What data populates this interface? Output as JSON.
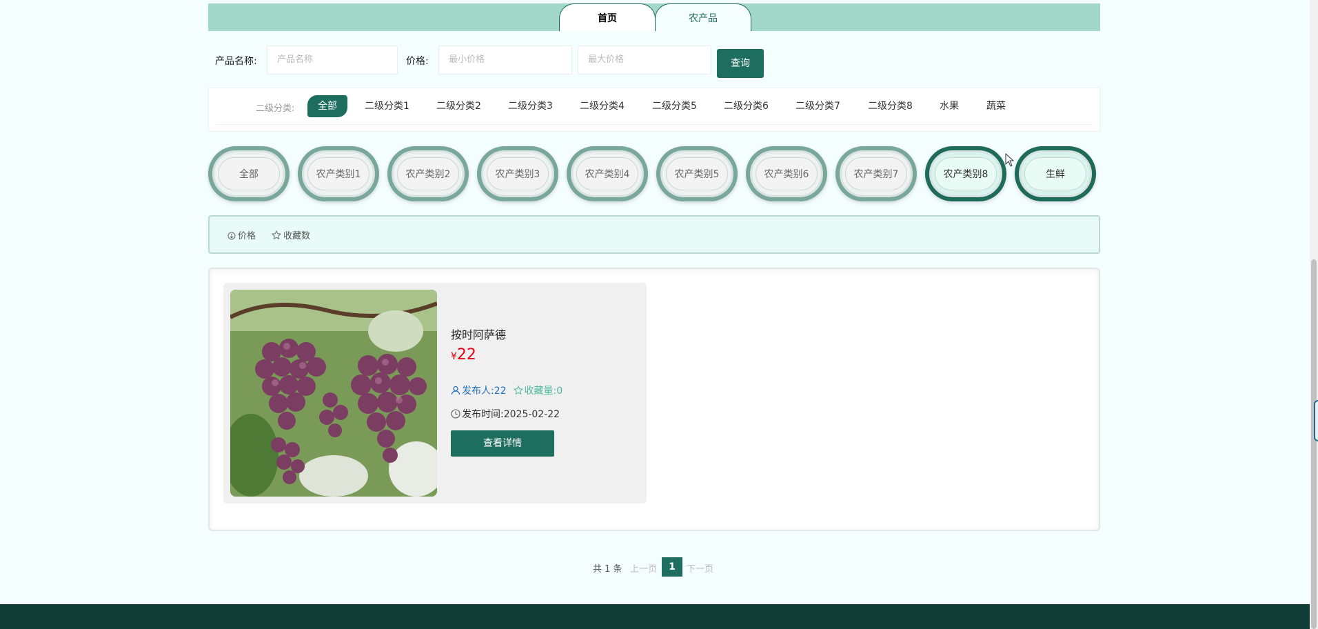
{
  "nav": {
    "tabs": [
      {
        "label": "首页"
      },
      {
        "label": "农产品"
      }
    ]
  },
  "search": {
    "name_label": "产品名称:",
    "name_placeholder": "产品名称",
    "price_label": "价格:",
    "min_placeholder": "最小价格",
    "max_placeholder": "最大价格",
    "query_label": "查询"
  },
  "subcategory": {
    "label": "二级分类:",
    "items": [
      "全部",
      "二级分类1",
      "二级分类2",
      "二级分类3",
      "二级分类4",
      "二级分类5",
      "二级分类6",
      "二级分类7",
      "二级分类8",
      "水果",
      "蔬菜"
    ],
    "active": "全部"
  },
  "categories": [
    "全部",
    "农产类别1",
    "农产类别2",
    "农产类别3",
    "农产类别4",
    "农产类别5",
    "农产类别6",
    "农产类别7",
    "农产类别8",
    "生鲜"
  ],
  "sort": {
    "price": "价格",
    "favorites": "收藏数"
  },
  "products": [
    {
      "name": "按时阿萨德",
      "currency": "¥",
      "price": "22",
      "publisher": "发布人:22",
      "favorites": "收藏量:0",
      "publish_time": "发布时间:2025-02-22",
      "detail_label": "查看详情",
      "image": "grapes-photo"
    }
  ],
  "pagination": {
    "total": "共 1 条",
    "prev": "上一页",
    "current": "1",
    "next": "下一页"
  },
  "colors": {
    "primary": "#1e6e5f",
    "nav_bg": "#a1d8c8",
    "price": "#e60012",
    "footer": "#123e37"
  }
}
